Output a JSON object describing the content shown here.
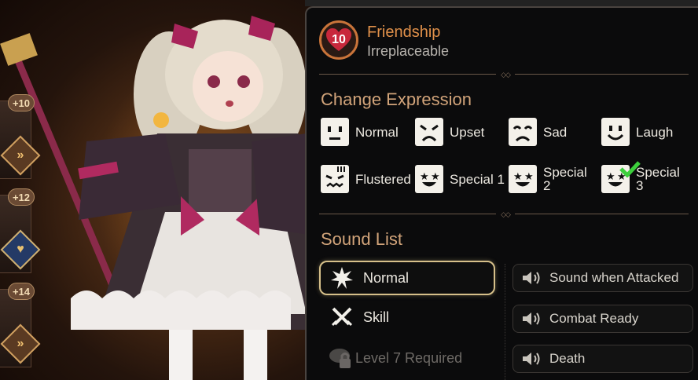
{
  "friendship": {
    "level": "10",
    "title": "Friendship",
    "subtitle": "Irreplaceable"
  },
  "expression": {
    "title": "Change Expression",
    "items": [
      {
        "label": "Normal",
        "icon": "face-normal-icon"
      },
      {
        "label": "Upset",
        "icon": "face-upset-icon"
      },
      {
        "label": "Sad",
        "icon": "face-sad-icon"
      },
      {
        "label": "Laugh",
        "icon": "face-laugh-icon"
      },
      {
        "label": "Flustered",
        "icon": "face-flustered-icon"
      },
      {
        "label": "Special 1",
        "icon": "face-special-icon"
      },
      {
        "label": "Special 2",
        "icon": "face-special-icon"
      },
      {
        "label": "Special 3",
        "icon": "face-special-icon",
        "selected": true
      }
    ]
  },
  "sound": {
    "title": "Sound List",
    "left": [
      {
        "label": "Normal",
        "icon": "burst-icon",
        "selected": true
      },
      {
        "label": "Skill",
        "icon": "crossed-swords-icon"
      },
      {
        "label": "Level 7 Required",
        "icon": "lock-icon",
        "locked": true
      }
    ],
    "right": [
      {
        "label": "Sound when Attacked",
        "icon": "speaker-icon"
      },
      {
        "label": "Combat Ready",
        "icon": "speaker-icon"
      },
      {
        "label": "Death",
        "icon": "speaker-icon"
      }
    ]
  },
  "side_cards": [
    {
      "level": "+10",
      "badge": "arrow-badge-icon"
    },
    {
      "level": "+12",
      "badge": "heart-badge-icon"
    },
    {
      "level": "+14",
      "badge": "arrow-badge-icon"
    }
  ],
  "colors": {
    "accent_orange": "#e0904a",
    "section_title": "#d2a47a",
    "selected_border": "#d6c08a",
    "check_green": "#3ccf3c"
  }
}
